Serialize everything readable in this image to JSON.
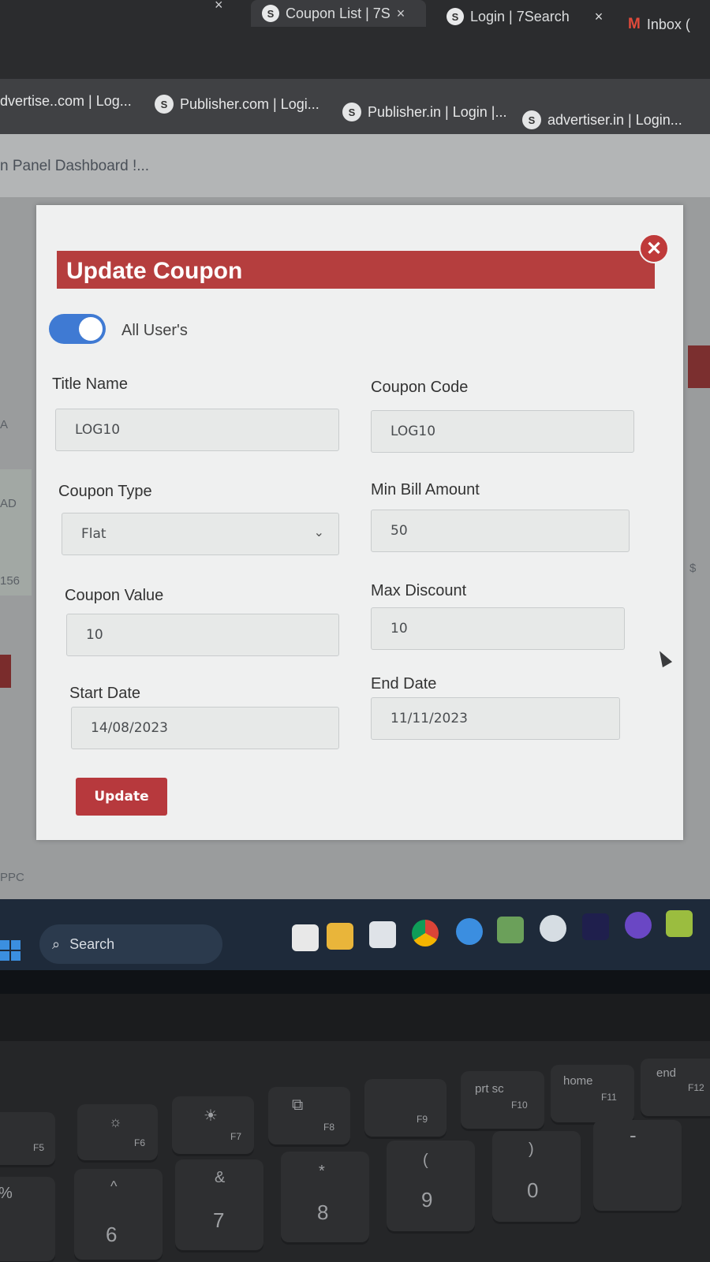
{
  "browser": {
    "tabs": [
      {
        "label": "Coupon List | 7S",
        "close": "×"
      },
      {
        "label": "Login | 7Search",
        "close": "×"
      },
      {
        "label": "Inbox (",
        "icon": "M"
      }
    ],
    "bookmarks": [
      {
        "label": "dvertise..com | Log..."
      },
      {
        "label": "Publisher.com | Logi..."
      },
      {
        "label": "Publisher.in | Login |..."
      },
      {
        "label": "advertiser.in | Login..."
      }
    ]
  },
  "page": {
    "title": "n Panel Dashboard !...",
    "fragments": [
      "A",
      "AD",
      "156",
      "PPC",
      "$"
    ]
  },
  "modal": {
    "title": "Update Coupon",
    "close_icon": "✕",
    "toggle": {
      "label": "All User's",
      "on": true
    },
    "fields": {
      "title_name": {
        "label": "Title Name",
        "value": "LOG10"
      },
      "coupon_code": {
        "label": "Coupon Code",
        "value": "LOG10"
      },
      "coupon_type": {
        "label": "Coupon Type",
        "value": "Flat"
      },
      "min_bill_amount": {
        "label": "Min Bill Amount",
        "value": "50"
      },
      "coupon_value": {
        "label": "Coupon Value",
        "value": "10"
      },
      "max_discount": {
        "label": "Max Discount",
        "value": "10"
      },
      "start_date": {
        "label": "Start Date",
        "value": "14/08/2023"
      },
      "end_date": {
        "label": "End Date",
        "value": "11/11/2023"
      }
    },
    "update_button": "Update"
  },
  "taskbar": {
    "search_label": "Search"
  },
  "keyboard": {
    "keys": [
      {
        "sub": "F5",
        "main": "%"
      },
      {
        "sub": "F6",
        "main": "6",
        "shift": "^"
      },
      {
        "sub": "F7",
        "main": "7",
        "shift": "&"
      },
      {
        "sub": "F8",
        "main": "8",
        "shift": "*"
      },
      {
        "sub": "F9",
        "main": "9",
        "shift": "("
      },
      {
        "sub": "F10",
        "label": "prt sc",
        "main": "0",
        "shift": ")"
      },
      {
        "sub": "F11",
        "label": "home",
        "main": "-"
      },
      {
        "sub": "F12",
        "label": "end"
      }
    ]
  },
  "colors": {
    "header_red": "#b53e3e",
    "toggle_blue": "#3f7ad3",
    "button_red": "#b7393d"
  }
}
